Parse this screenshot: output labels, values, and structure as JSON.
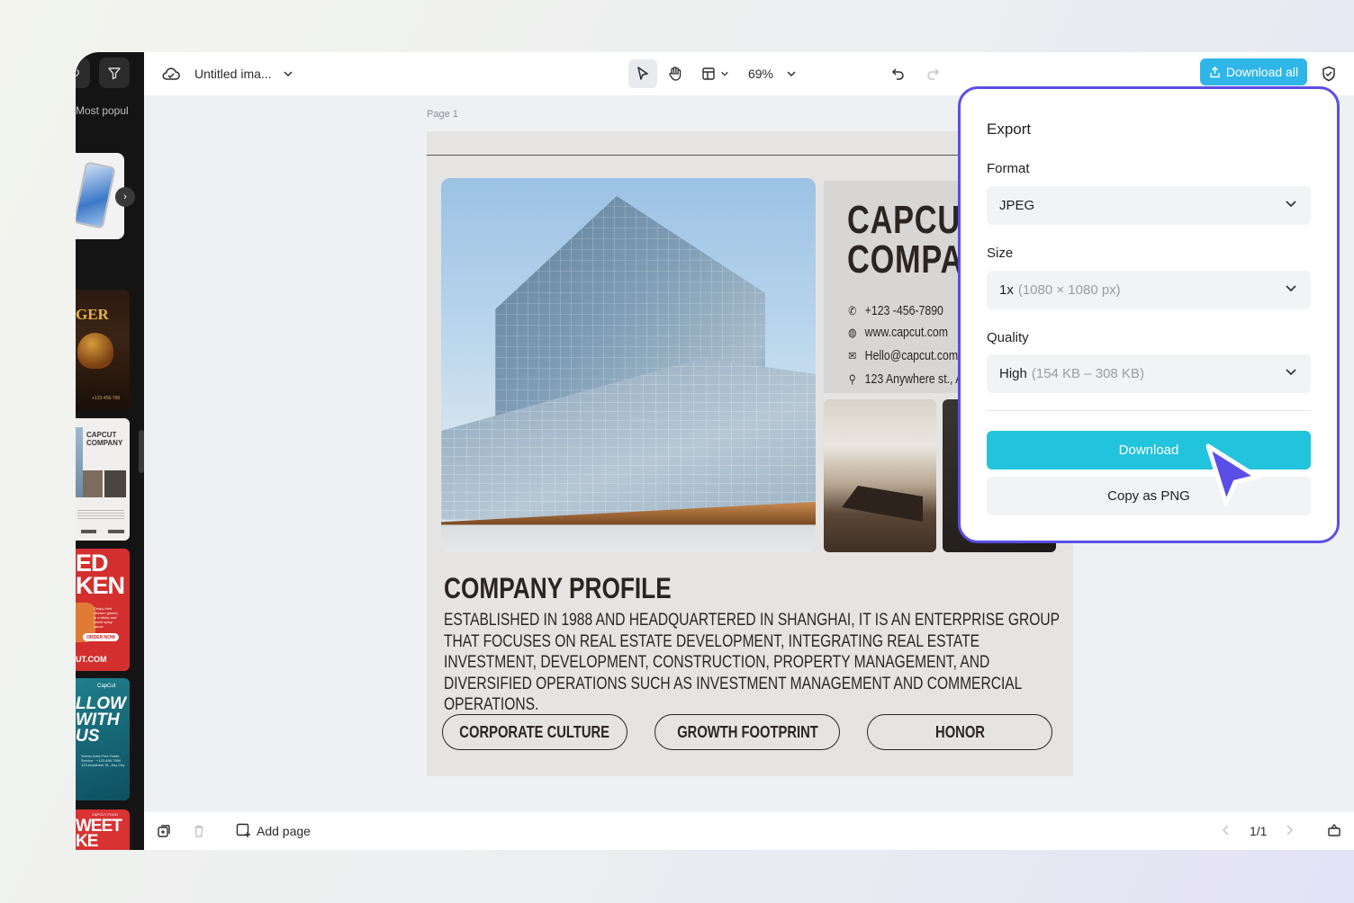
{
  "leftpanel": {
    "section_label": "Most popul",
    "templates": {
      "burger": "GER",
      "burger_small": "+123-456-789",
      "company": "CAPCUT COMPANY",
      "chicken": "ED KEN",
      "chicken_desc": "Crispy fried chicken glazed in a sticky and sweet spicy sauce",
      "chicken_order": "ORDER NOW",
      "chicken_url": "UT.COM",
      "follow_logo": "CapCut",
      "follow": "LLOW WITH US",
      "follow_info": "Scenic Area Free Guide Service · +123-456-7890 · 123 Anywhere St., Any City",
      "sweet_tag": "CAPCUT FOOD",
      "sweet": "WEET KE"
    }
  },
  "topbar": {
    "doc_title": "Untitled ima...",
    "zoom": "69%",
    "download_all": "Download all"
  },
  "canvas": {
    "page_label": "Page 1",
    "design": {
      "title_line1": "CAPCUT",
      "title_line2": "COMPANY",
      "phone": "+123 -456-7890",
      "website": "www.capcut.com",
      "email": "Hello@capcut.com",
      "address": "123 Anywhere st., Any City",
      "heading": "COMPANY PROFILE",
      "body": "ESTABLISHED IN 1988 AND HEADQUARTERED IN SHANGHAI, IT IS AN ENTERPRISE GROUP THAT FOCUSES ON REAL ESTATE DEVELOPMENT, INTEGRATING REAL ESTATE INVESTMENT, DEVELOPMENT, CONSTRUCTION, PROPERTY MANAGEMENT, AND DIVERSIFIED OPERATIONS SUCH AS INVESTMENT MANAGEMENT AND COMMERCIAL OPERATIONS.",
      "buttons": [
        "CORPORATE CULTURE",
        "GROWTH FOOTPRINT",
        "HONOR"
      ]
    }
  },
  "bottombar": {
    "add_page": "Add page",
    "pagination": "1/1"
  },
  "export": {
    "title": "Export",
    "format_label": "Format",
    "format_value": "JPEG",
    "size_label": "Size",
    "size_value": "1x",
    "size_detail": "(1080 × 1080 px)",
    "quality_label": "Quality",
    "quality_value": "High",
    "quality_detail": "(154 KB – 308 KB)",
    "download": "Download",
    "copy_png": "Copy as PNG"
  },
  "colors": {
    "accent_cyan": "#22c3dc",
    "download_all_bg": "#2eb6e8",
    "panel_border": "#5b4ee6",
    "cursor": "#5b4ee6"
  }
}
